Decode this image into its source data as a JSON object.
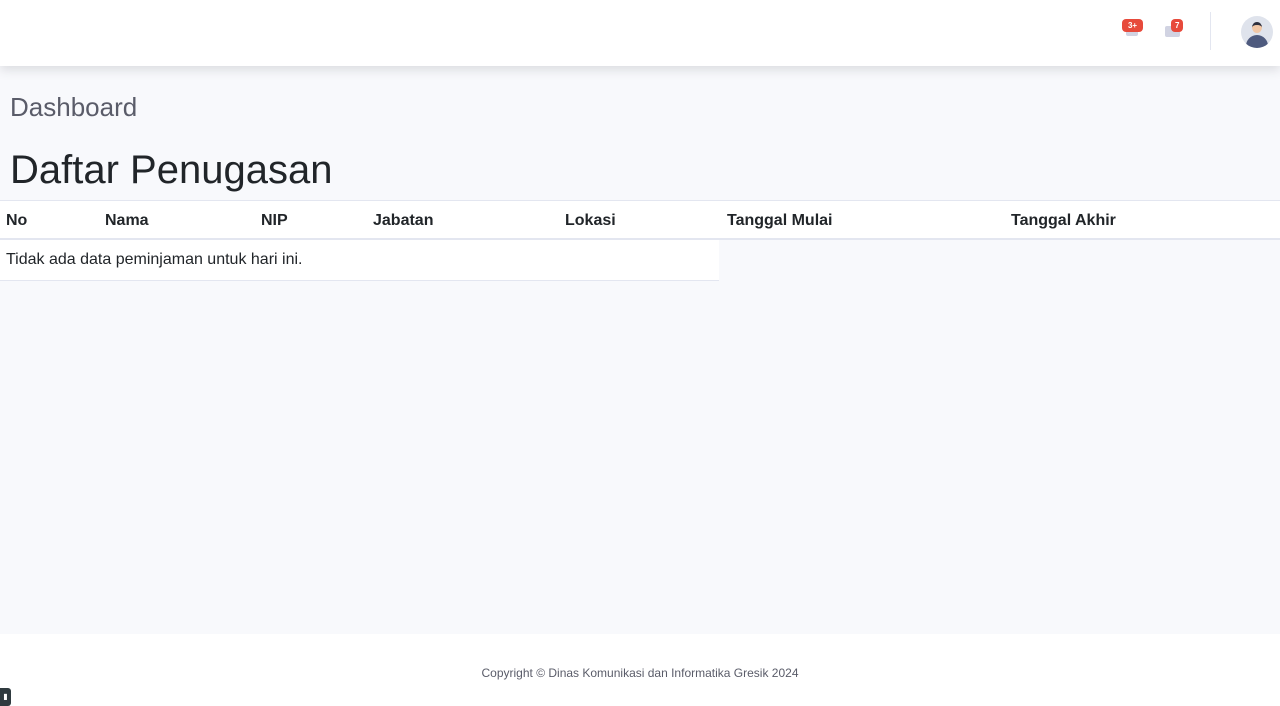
{
  "topbar": {
    "alerts": {
      "icon": "bell-icon",
      "badge": "3+"
    },
    "messages": {
      "icon": "envelope-icon",
      "badge": "7"
    },
    "profile": {
      "icon": "user-avatar-icon"
    }
  },
  "page": {
    "heading": "Dashboard",
    "section_title": "Daftar Penugasan"
  },
  "table": {
    "columns": [
      "No",
      "Nama",
      "NIP",
      "Jabatan",
      "Lokasi",
      "Tanggal Mulai",
      "Tanggal Akhir"
    ],
    "empty_message": "Tidak ada data peminjaman untuk hari ini."
  },
  "footer": {
    "copyright": "Copyright © Dinas Komunikasi dan Informatika Gresik 2024"
  },
  "colors": {
    "badge": "#e74a3b",
    "background": "#f8f9fc",
    "surface": "#ffffff",
    "heading_gray": "#5a5c69"
  }
}
